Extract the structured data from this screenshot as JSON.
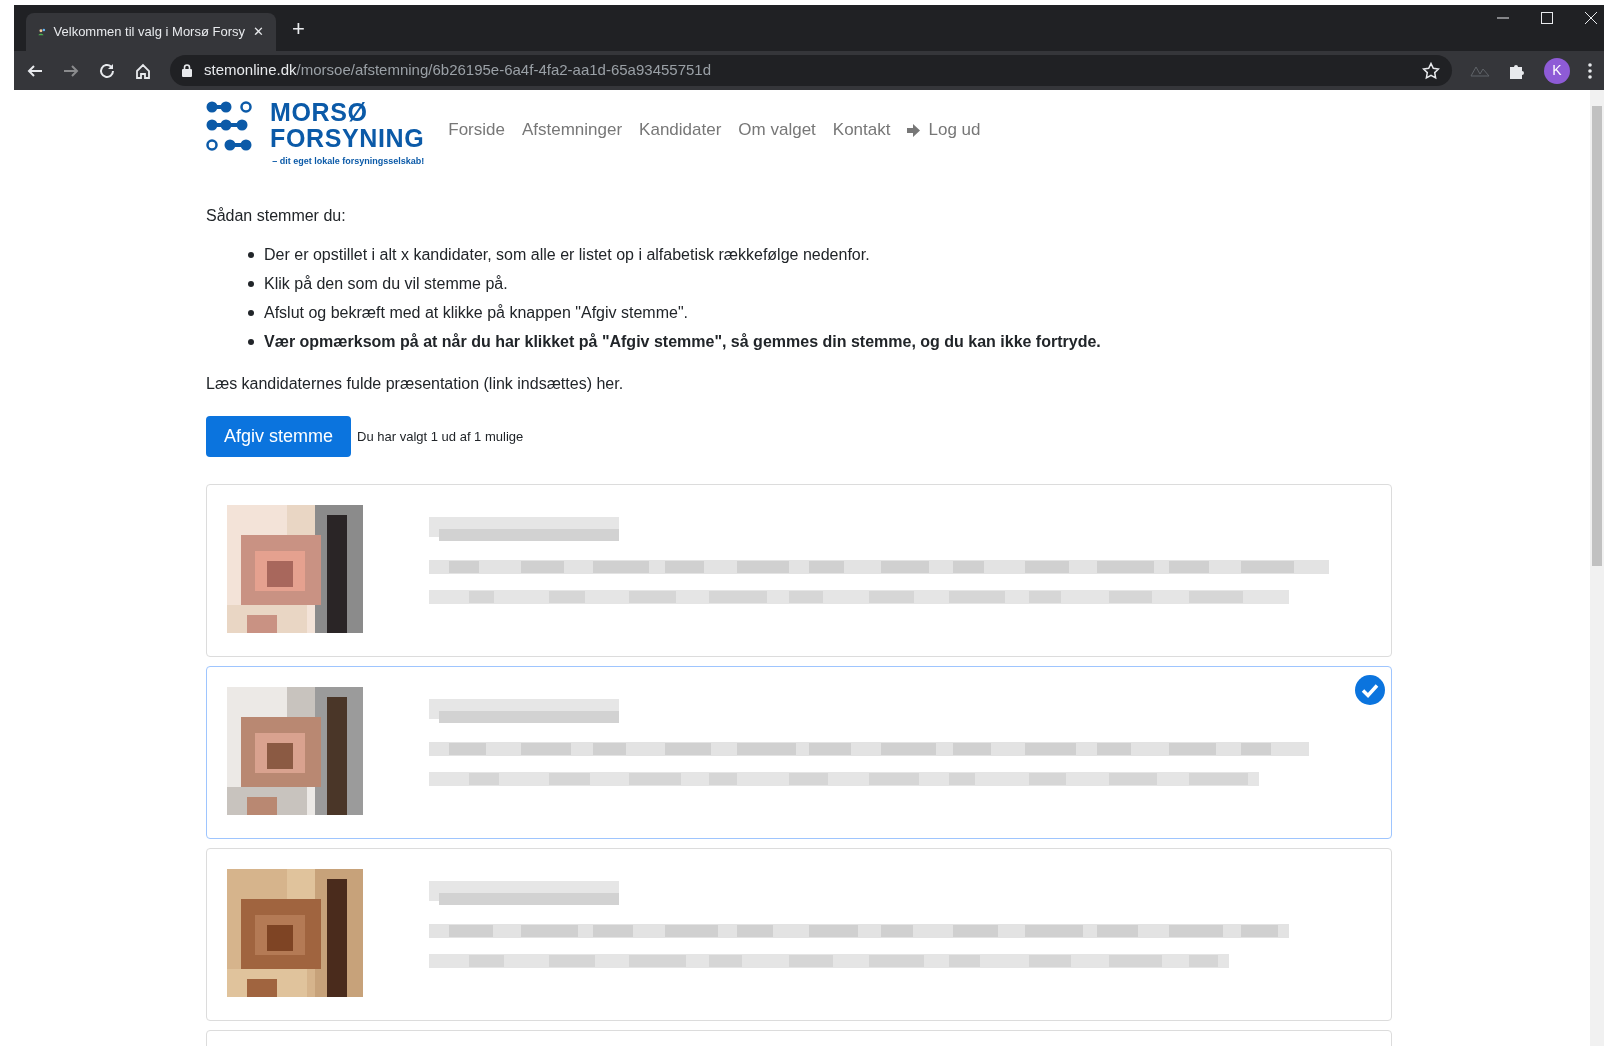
{
  "browser": {
    "tab_title": "Velkommen til valg i Morsø Forsy",
    "tab_close": "✕",
    "new_tab": "+",
    "url_host": "stemonline.dk",
    "url_path": "/morsoe/afstemning/6b26195e-6a4f-4fa2-aa1d-65a93455751d",
    "profile_initial": "K"
  },
  "logo": {
    "line_1": "MORSØ",
    "line_2": "FORSYNING",
    "tagline": "– dit eget lokale forsyningsselskab!"
  },
  "nav": [
    {
      "label": "Forside",
      "kind": "link"
    },
    {
      "label": "Afstemninger",
      "kind": "link"
    },
    {
      "label": "Kandidater",
      "kind": "link"
    },
    {
      "label": "Om valget",
      "kind": "link"
    },
    {
      "label": "Kontakt",
      "kind": "link"
    },
    {
      "label": "Log ud",
      "kind": "logout"
    }
  ],
  "intro": "Sådan stemmer du:",
  "steps": [
    {
      "text": "Der er opstillet i alt x kandidater, som alle er listet op i alfabetisk rækkefølge nedenfor.",
      "bold": false
    },
    {
      "text": "Klik på den som du vil stemme på.",
      "bold": false
    },
    {
      "text": "Afslut og bekræft med at klikke på knappen \"Afgiv stemme\".",
      "bold": false
    },
    {
      "text": "Vær opmærksom på at når du har klikket på \"Afgiv stemme\", så gemmes din stemme, og du kan ikke fortryde.",
      "bold": true
    }
  ],
  "presentation_note": "Læs kandidaternes fulde præsentation (link indsættes) her.",
  "vote_button": "Afgiv stemme",
  "selection_status": "Du har valgt 1 ud af 1 mulige",
  "candidates": [
    {
      "selected": false,
      "kind": "full"
    },
    {
      "selected": true,
      "kind": "full"
    },
    {
      "selected": false,
      "kind": "full"
    },
    {
      "selected": false,
      "kind": "cut"
    }
  ]
}
